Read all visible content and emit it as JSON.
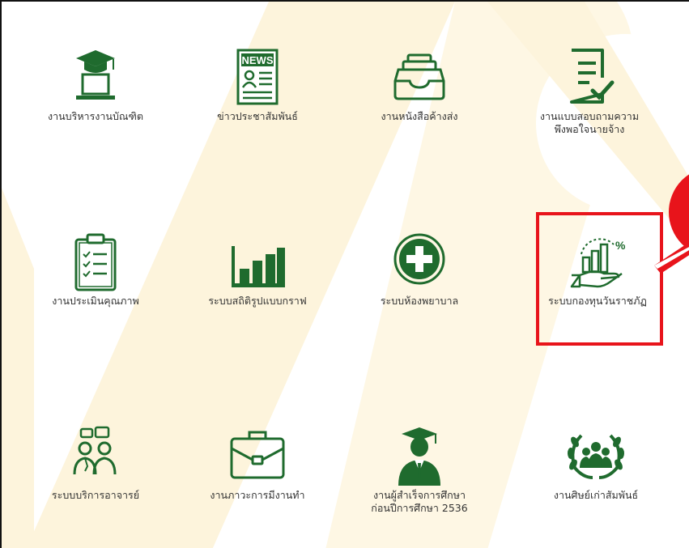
{
  "colors": {
    "icon_green": "#1f6b2e",
    "highlight_red": "#e8141b",
    "bg_stripe": "#fdf4dc"
  },
  "tiles": [
    {
      "icon": "graduate-laptop-icon",
      "label": "งานบริหารงานบัณฑิต"
    },
    {
      "icon": "news-icon",
      "label": "ข่าวประชาสัมพันธ์",
      "icon_text": "NEWS"
    },
    {
      "icon": "inbox-tray-icon",
      "label": "งานหนังสือค้างส่ง"
    },
    {
      "icon": "checklist-document-icon",
      "label": "งานแบบสอบถามความ\nพึงพอใจนายจ้าง"
    },
    {
      "icon": "clipboard-checklist-icon",
      "label": "งานประเมินคุณภาพ"
    },
    {
      "icon": "bar-chart-icon",
      "label": "ระบบสถิติรูปแบบกราฟ"
    },
    {
      "icon": "medical-cross-icon",
      "label": "ระบบห้องพยาบาล"
    },
    {
      "icon": "fund-hand-chart-icon",
      "label": "ระบบกองทุนวันราชภัฏ"
    },
    {
      "icon": "consultation-icon",
      "label": "ระบบบริการอาจารย์"
    },
    {
      "icon": "briefcase-icon",
      "label": "งานภาวะการมีงานทำ"
    },
    {
      "icon": "graduate-person-icon",
      "label": "งานผู้สำเร็จการศึกษา\nก่อนปีการศึกษา 2536"
    },
    {
      "icon": "alumni-laurel-icon",
      "label": "งานศิษย์เก่าสัมพันธ์"
    }
  ]
}
